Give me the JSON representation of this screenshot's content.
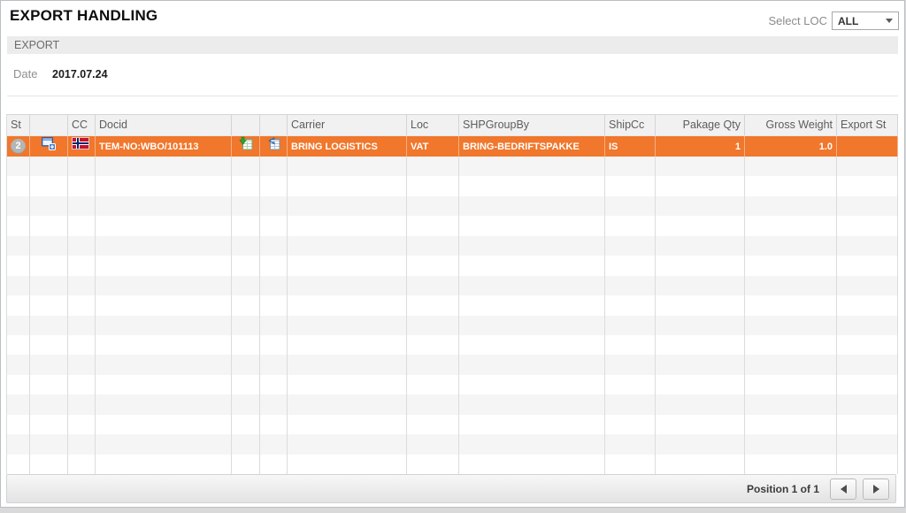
{
  "page": {
    "title": "EXPORT HANDLING",
    "select_loc_label": "Select LOC",
    "select_loc_value": "ALL"
  },
  "panel": {
    "header": "EXPORT",
    "date_label": "Date",
    "date_value": "2017.07.24"
  },
  "table": {
    "columns": [
      "St",
      "",
      "CC",
      "Docid",
      "",
      "",
      "Carrier",
      "Loc",
      "SHPGroupBy",
      "ShipCc",
      "Pakage Qty",
      "Gross Weight",
      "Export St"
    ],
    "row": {
      "st_badge": "2",
      "row_type_icon": "open-document-icon",
      "cc_flag_icon": "norway-flag-icon",
      "docid": "TEM-NO:WBO/101113",
      "action_icon_1": "export-excel-icon",
      "action_icon_2": "import-excel-icon",
      "carrier": "BRING LOGISTICS",
      "loc": "VAT",
      "shp_group_by": "BRING-BEDRIFTSPAKKE",
      "ship_cc": "IS",
      "pakage_qty": "1",
      "gross_weight": "1.0",
      "export_st": ""
    }
  },
  "footer": {
    "position_text": "Position 1 of 1"
  },
  "colors": {
    "selected_row": "#F0772C",
    "header_bg": "#F1F1F1",
    "stripe_bg": "#F5F5F5",
    "grid_line": "#DCDCDC",
    "badge_bg": "#B5B5B5",
    "flag_red": "#C8102E",
    "flag_blue": "#002868"
  }
}
